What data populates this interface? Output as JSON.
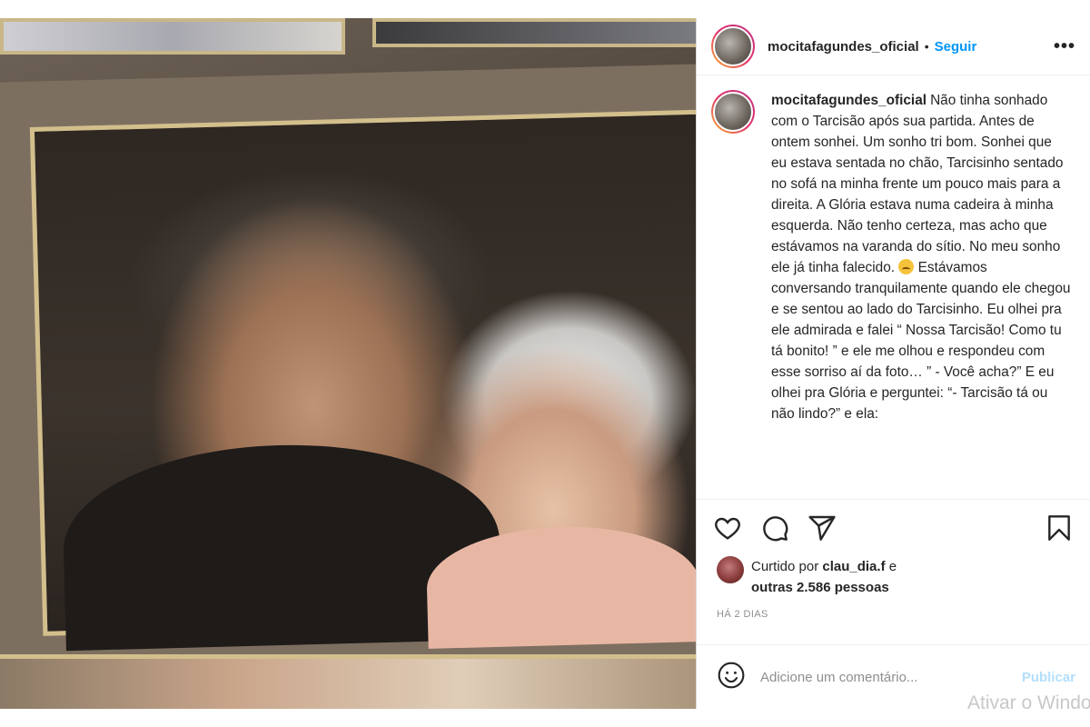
{
  "post": {
    "username": "mocitafagundes_oficial",
    "separator": "•",
    "follow_label": "Seguir",
    "more_label": "•••"
  },
  "caption": {
    "username": "mocitafagundes_oficial",
    "text_before_emoji": "Não tinha sonhado com o Tarcisão após sua partida. Antes de ontem sonhei. Um sonho tri bom. Sonhei que eu estava sentada no chão, Tarcisinho sentado no sofá na minha frente um pouco mais para a direita. A Glória estava numa cadeira à minha esquerda. Não tenho certeza, mas acho que estávamos na varanda do sítio. No meu sonho ele já tinha falecido.",
    "emoji_name": "sad-face-emoji",
    "text_after_emoji": " Estávamos conversando tranquilamente quando ele chegou e se sentou ao lado do Tarcisinho. Eu olhei pra ele admirada e falei “ Nossa Tarcisão! Como tu tá bonito! ” e ele me olhou e respondeu com esse sorriso aí da foto… ” - Você acha?” E eu olhei pra Glória e perguntei: “- Tarcisão tá ou não lindo?”  e ela:"
  },
  "actions": {
    "like_icon": "heart-icon",
    "comment_icon": "comment-icon",
    "share_icon": "share-icon",
    "save_icon": "bookmark-icon"
  },
  "likes": {
    "prefix": "Curtido por ",
    "liker": "clau_dia.f",
    "middle": " e",
    "others": "outras 2.586 pessoas"
  },
  "timestamp": "HÁ 2 DIAS",
  "comment": {
    "placeholder": "Adicione um comentário...",
    "publish_label": "Publicar"
  },
  "watermark": "Ativar o Windows",
  "colors": {
    "link_blue": "#0095f6",
    "publish_disabled": "#b2dffc",
    "muted": "#8e8e8e"
  }
}
